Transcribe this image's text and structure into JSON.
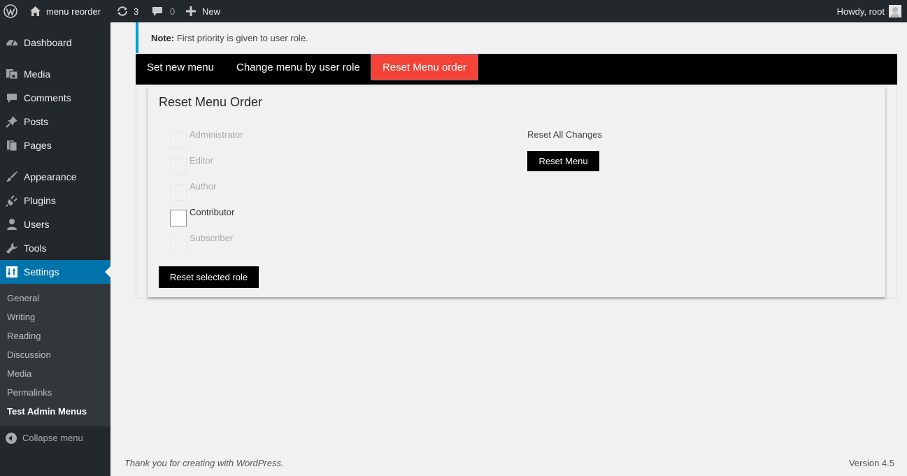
{
  "adminbar": {
    "site_name": "menu reorder",
    "updates_count": "3",
    "comments_count": "0",
    "new_label": "New",
    "howdy": "Howdy, root"
  },
  "sidebar": {
    "items": [
      {
        "label": "Dashboard",
        "icon": "dashboard-icon"
      },
      {
        "label": "Media",
        "icon": "media-icon"
      },
      {
        "label": "Comments",
        "icon": "comments-icon"
      },
      {
        "label": "Posts",
        "icon": "pin-icon"
      },
      {
        "label": "Pages",
        "icon": "pages-icon"
      },
      {
        "label": "Appearance",
        "icon": "brush-icon"
      },
      {
        "label": "Plugins",
        "icon": "plug-icon"
      },
      {
        "label": "Users",
        "icon": "user-icon"
      },
      {
        "label": "Tools",
        "icon": "wrench-icon"
      },
      {
        "label": "Settings",
        "icon": "settings-icon"
      }
    ],
    "submenu": [
      "General",
      "Writing",
      "Reading",
      "Discussion",
      "Media",
      "Permalinks",
      "Test Admin Menus"
    ],
    "collapse_label": "Collapse menu"
  },
  "notice": {
    "strong": "Note:",
    "text": " First priority is given to user role."
  },
  "tabs": [
    "Set new menu",
    "Change menu by user role",
    "Reset Menu order"
  ],
  "card": {
    "title": "Reset Menu Order",
    "roles": [
      {
        "label": "Administrator",
        "enabled": false
      },
      {
        "label": "Editor",
        "enabled": false
      },
      {
        "label": "Author",
        "enabled": false
      },
      {
        "label": "Contributor",
        "enabled": true
      },
      {
        "label": "Subscriber",
        "enabled": false
      }
    ],
    "reset_selected_label": "Reset selected role",
    "reset_all_heading": "Reset All Changes",
    "reset_menu_label": "Reset Menu"
  },
  "footer": {
    "thanks": "Thank you for creating with WordPress.",
    "version": "Version 4.5"
  },
  "colors": {
    "adminbar_bg": "#23282d",
    "active_menu": "#0073aa",
    "active_tab": "#f44336",
    "notice_border": "#00a0d2"
  }
}
